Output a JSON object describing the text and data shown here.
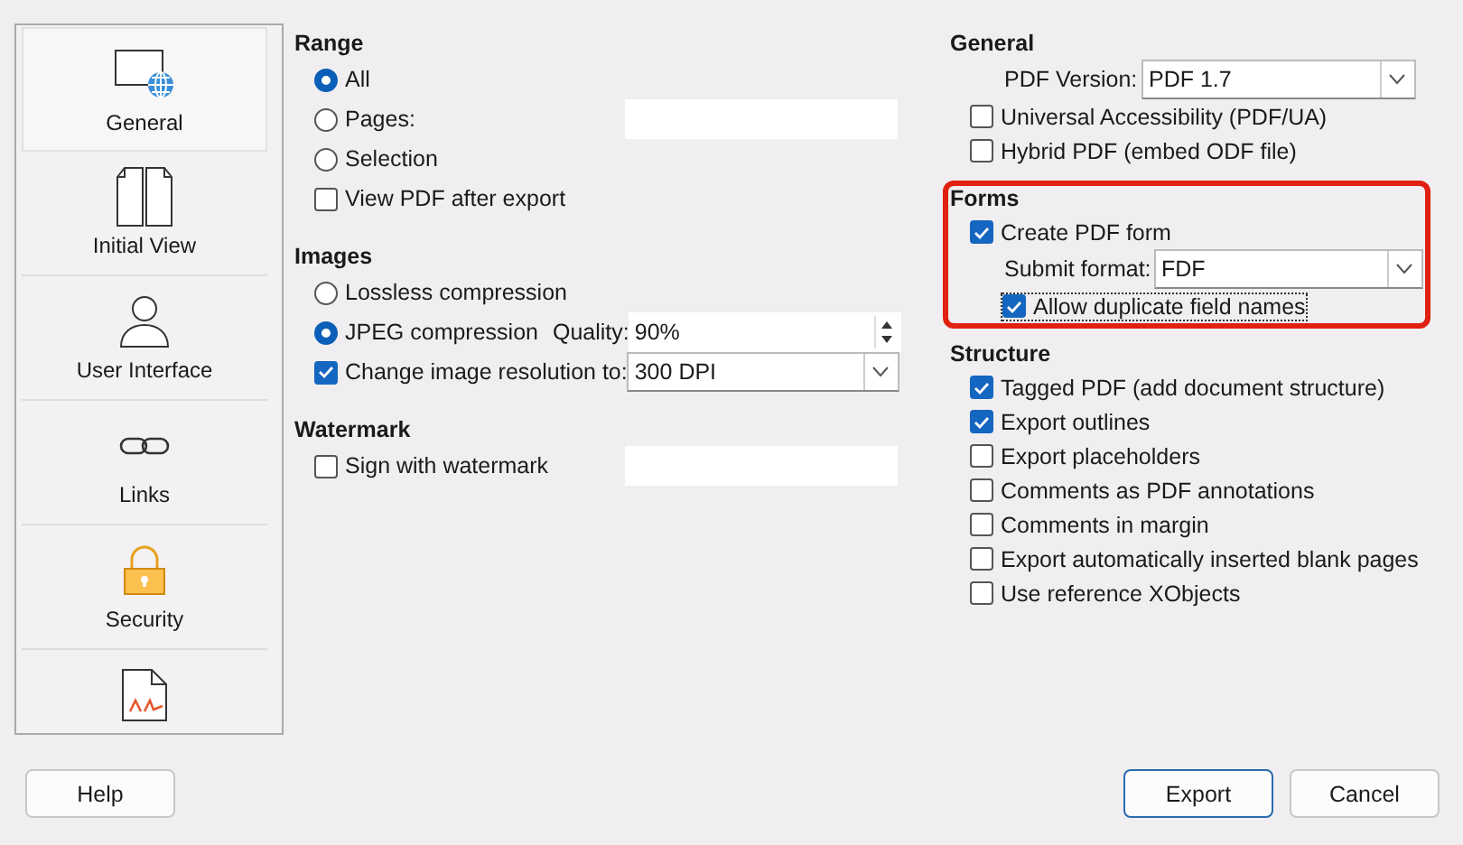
{
  "sidebar": {
    "items": [
      {
        "label": "General",
        "selected": true
      },
      {
        "label": "Initial View",
        "selected": false
      },
      {
        "label": "User Interface",
        "selected": false
      },
      {
        "label": "Links",
        "selected": false
      },
      {
        "label": "Security",
        "selected": false
      },
      {
        "selected": false
      }
    ]
  },
  "left_sections": [
    {
      "title": "Range",
      "rows": [
        {
          "kind": "radio",
          "label": "All",
          "selected": true
        },
        {
          "kind": "radio",
          "label": "Pages:",
          "selected": false,
          "field": {
            "kind": "text"
          }
        },
        {
          "kind": "radio",
          "label": "Selection",
          "selected": false
        },
        {
          "kind": "checkbox",
          "label": "View PDF after export",
          "checked": false
        }
      ]
    },
    {
      "title": "Images",
      "rows": [
        {
          "kind": "radio",
          "label": "Lossless compression",
          "selected": false
        },
        {
          "kind": "radio",
          "label": "JPEG compression",
          "selected": true,
          "field_label": "Quality:",
          "field": {
            "kind": "spin",
            "value": "90%"
          }
        },
        {
          "kind": "checkbox",
          "label": "Change image resolution to:",
          "checked": true,
          "field": {
            "kind": "combo",
            "value": "300 DPI"
          }
        }
      ]
    },
    {
      "title": "Watermark",
      "rows": [
        {
          "kind": "checkbox",
          "label": "Sign with watermark",
          "checked": false,
          "field": {
            "kind": "text"
          }
        }
      ]
    }
  ],
  "right_sections": [
    {
      "title": "General",
      "rows": [
        {
          "kind": "select",
          "label": "PDF Version:",
          "field": {
            "kind": "combo",
            "value": "PDF 1.7"
          }
        },
        {
          "kind": "checkbox",
          "label": "Universal Accessibility (PDF/UA)",
          "checked": false
        },
        {
          "kind": "checkbox",
          "label": "Hybrid PDF (embed ODF file)",
          "checked": false
        }
      ]
    },
    {
      "title": "Forms",
      "highlighted": true,
      "rows": [
        {
          "kind": "checkbox",
          "label": "Create PDF form",
          "checked": true
        },
        {
          "kind": "select",
          "label": "Submit format:",
          "field": {
            "kind": "combo",
            "value": "FDF"
          }
        },
        {
          "kind": "sub-checkbox",
          "label": "Allow duplicate field names",
          "checked": true,
          "focused": true
        }
      ]
    },
    {
      "title": "Structure",
      "rows": [
        {
          "kind": "checkbox",
          "label": "Tagged PDF (add document structure)",
          "checked": true
        },
        {
          "kind": "checkbox",
          "label": "Export outlines",
          "checked": true
        },
        {
          "kind": "checkbox",
          "label": "Export placeholders",
          "checked": false
        },
        {
          "kind": "checkbox",
          "label": "Comments as PDF annotations",
          "checked": false
        },
        {
          "kind": "checkbox",
          "label": "Comments in margin",
          "checked": false
        },
        {
          "kind": "checkbox",
          "label": "Export automatically inserted blank pages",
          "checked": false
        },
        {
          "kind": "checkbox",
          "label": "Use reference XObjects",
          "checked": false
        }
      ]
    }
  ],
  "buttons": [
    {
      "label": "Help",
      "default": false
    },
    {
      "label": "Export",
      "default": true
    },
    {
      "label": "Cancel",
      "default": false
    }
  ]
}
